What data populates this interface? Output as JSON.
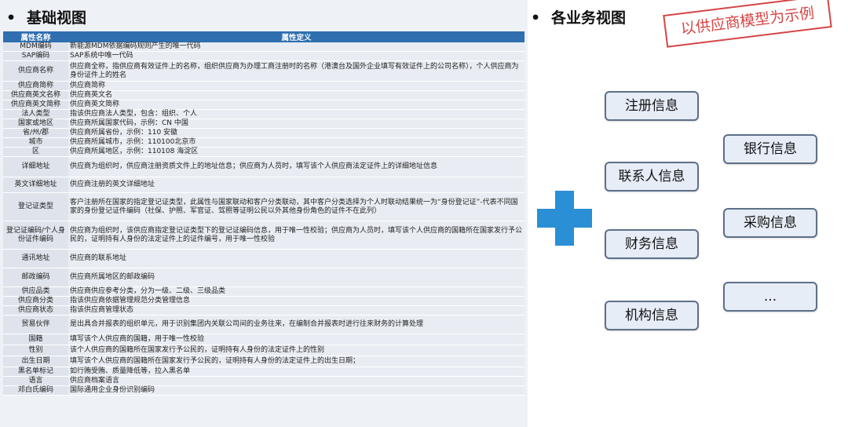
{
  "left": {
    "heading": "基础视图",
    "table": {
      "headers": [
        "属性名称",
        "属性定义"
      ],
      "rows": [
        {
          "name": "MDM编码",
          "desc": "新能源MDM依据编码规则产生的唯一代码"
        },
        {
          "name": "SAP编码",
          "desc": "SAP系统中唯一代码"
        },
        {
          "name": "供应商名称",
          "desc": "供应商全称，指供应商有效证件上的名称，组织供应商为办理工商注册时的名称（港澳台及国外企业填写有效证件上的公司名称），个人供应商为身份证件上的姓名"
        },
        {
          "name": "供应商简称",
          "desc": "供应商简称"
        },
        {
          "name": "供应商英文名称",
          "desc": "供应商英文名"
        },
        {
          "name": "供应商英文简称",
          "desc": "供应商英文简称"
        },
        {
          "name": "法人类型",
          "desc": "指该供应商法人类型，包含：组织、个人"
        },
        {
          "name": "国家或地区",
          "desc": "供应商所属国家代码，示例：CN 中国"
        },
        {
          "name": "省/州/郡",
          "desc": "供应商所属省份，示例：110 安徽"
        },
        {
          "name": "城市",
          "desc": "供应商所属城市，示例：110100北京市"
        },
        {
          "name": "区",
          "desc": "供应商所属地区，示例：110108 海淀区"
        },
        {
          "name": "详细地址",
          "desc": "供应商为组织时，供应商注册资质文件上的地址信息；供应商为人员时，填写该个人供应商法定证件上的详细地址信息"
        },
        {
          "name": "英文详细地址",
          "desc": "供应商注册的英文详细地址"
        },
        {
          "name": "登记证类型",
          "desc": "客户注册所在国家的指定登记证类型，此属性与国家联动和客户分类联动，其中客户分类选择为个人时联动结果统一为“身份登记证”-代表不同国家的身份登记证件编码（社保、护照、军官证、驾照等证明公民以外其他身份角色的证件不在此列）"
        },
        {
          "name": "登记证编码/个人身份证件编码",
          "desc": "供应商为组织时，该供应商指定登记证类型下的登记证编码信息，用于唯一性校验；供应商为人员时，填写该个人供应商的国籍所在国家发行予公民的，证明持有人身份的法定证件上的证件编号，用于唯一性校验"
        },
        {
          "name": "通讯地址",
          "desc": "供应商的联系地址"
        },
        {
          "name": "邮政编码",
          "desc": "供应商所属地区的邮政编码"
        },
        {
          "name": "供应品类",
          "desc": "供应商供应参考分类，分为一级、二级、三级品类"
        },
        {
          "name": "供应商分类",
          "desc": "指该供应商依据管理规范分类管理信息"
        },
        {
          "name": "供应商状态",
          "desc": "指该供应商管理状态"
        },
        {
          "name": "贸易伙伴",
          "desc": "是出具合并报表的组织单元，用于识别集团内关联公司间的业务往来，在编制合并报表时进行往来财务的计算处理"
        },
        {
          "name": "国籍",
          "desc": "填写该个人供应商的国籍，用于唯一性校验"
        },
        {
          "name": "性别",
          "desc": "该个人供应商的国籍所在国家发行予公民的，证明持有人身份的法定证件上的性别"
        },
        {
          "name": "出生日期",
          "desc": "填写该个人供应商的国籍所在国家发行予公民的，证明持有人身份的法定证件上的出生日期；"
        },
        {
          "name": "黑名单标记",
          "desc": "如行贿受贿、质量降低等，拉入黑名单"
        },
        {
          "name": "语言",
          "desc": "供应商档案语言"
        },
        {
          "name": "邓白氏编码",
          "desc": "国际通用企业身份识别编码"
        }
      ]
    }
  },
  "right": {
    "heading": "各业务视图",
    "stamp": "以供应商模型为示例",
    "boxes": [
      "注册信息",
      "联系人信息",
      "财务信息",
      "机构信息",
      "银行信息",
      "采购信息",
      "..."
    ]
  },
  "colors": {
    "header_bg": "#2f6fb0",
    "plus": "#2a8fd4",
    "stamp": "#d64545"
  }
}
